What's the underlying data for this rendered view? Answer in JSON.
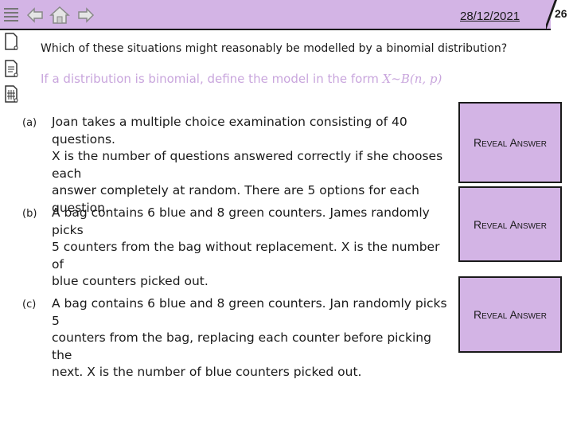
{
  "header": {
    "date": "28/12/2021",
    "slide_number": "26",
    "icons": [
      "menu-icon",
      "back-arrow-icon",
      "home-icon",
      "forward-arrow-icon"
    ]
  },
  "sidebar": {
    "icons": [
      "blank-page-icon",
      "notes-page-icon",
      "table-page-icon"
    ]
  },
  "question": "Which of these situations might reasonably be modelled by a binomial distribution?",
  "instruction": {
    "text": "If a distribution is binomial, define the model in the form ",
    "model": "X~B(n, p)"
  },
  "parts": [
    {
      "label": "(a)",
      "lines": [
        "Joan takes a multiple choice examination consisting of 40 questions.",
        "X is the number of questions answered correctly if she chooses each",
        "answer completely at random. There are 5 options for each question."
      ]
    },
    {
      "label": "(b)",
      "lines": [
        "A bag contains 6 blue and 8 green counters.  James randomly picks",
        "5 counters from the bag without replacement. X is the number of",
        "blue counters picked out."
      ]
    },
    {
      "label": "(c)",
      "lines": [
        "A bag contains 6 blue and 8 green counters. Jan randomly picks 5",
        "counters from the bag, replacing each counter before picking the",
        "next. X is the number of blue counters picked out."
      ]
    }
  ],
  "reveal_label": "Reveal Answer",
  "colors": {
    "accent": "#d3b4e5",
    "instruction": "#c9a6dd",
    "border": "#1a1a1a"
  }
}
